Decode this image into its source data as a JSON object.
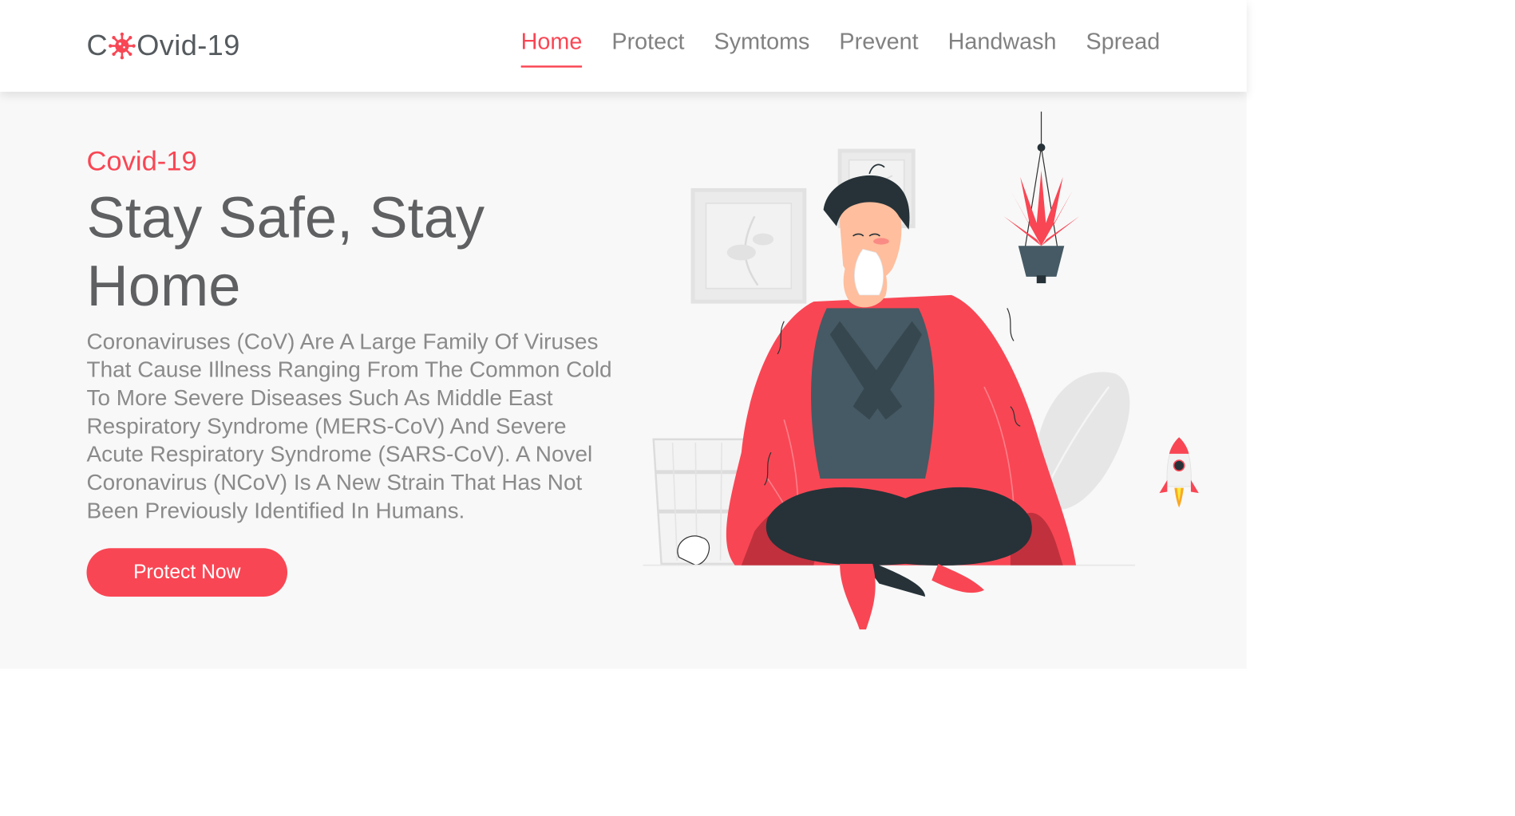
{
  "header": {
    "logo": {
      "prefix": "C",
      "suffix": "Ovid-19",
      "icon": "virus-icon"
    },
    "nav": [
      {
        "label": "Home",
        "active": true
      },
      {
        "label": "Protect",
        "active": false
      },
      {
        "label": "Symtoms",
        "active": false
      },
      {
        "label": "Prevent",
        "active": false
      },
      {
        "label": "Handwash",
        "active": false
      },
      {
        "label": "Spread",
        "active": false
      }
    ]
  },
  "hero": {
    "eyebrow": "Covid-19",
    "headline": "Stay Safe, Stay Home",
    "description": "Coronaviruses (CoV) Are A Large Family Of Viruses That Cause Illness Ranging From The Common Cold To More Severe Diseases Such As Middle East Respiratory Syndrome (MERS-CoV) And Severe Acute Respiratory Syndrome (SARS-CoV). A Novel Coronavirus (NCoV) Is A New Strain That Has Not Been Previously Identified In Humans.",
    "cta_label": "Protect Now",
    "illustration": "sick-person-with-blanket-illustration"
  },
  "scroll_top_icon": "rocket-icon",
  "colors": {
    "accent": "#f94654",
    "text_dark": "#5f6062",
    "text_muted": "#8a8a8a",
    "nav_text": "#818181",
    "background": "#f8f8f8",
    "header_bg": "#ffffff"
  }
}
